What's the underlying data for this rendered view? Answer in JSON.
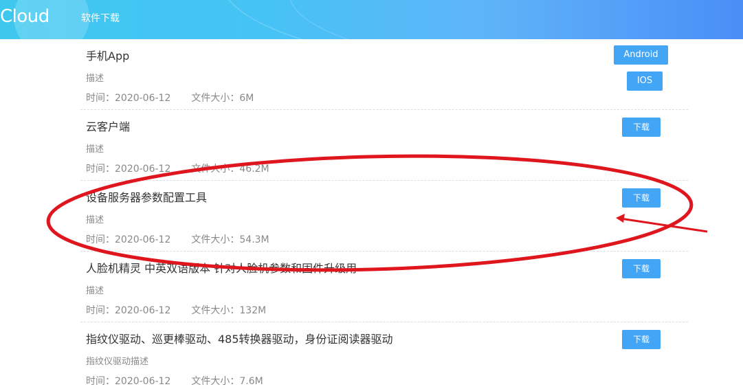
{
  "header": {
    "logo": "Cloud",
    "nav_item": "软件下载"
  },
  "items": [
    {
      "title": "手机App",
      "desc": "描述",
      "time": "时间：2020-06-12",
      "size": "文件大小：6M",
      "buttons": {
        "android": "Android",
        "ios": "IOS"
      }
    },
    {
      "title": "云客户端",
      "desc": "描述",
      "time": "时间：2020-06-12",
      "size": "文件大小：46.2M",
      "button": "下载"
    },
    {
      "title": "设备服务器参数配置工具",
      "desc": "描述",
      "time": "时间：2020-06-12",
      "size": "文件大小：54.3M",
      "button": "下载"
    },
    {
      "title": "人脸机精灵 中英双语版本 针对人脸机参数和固件升级用",
      "desc": "描述",
      "time": "时间：2020-06-12",
      "size": "文件大小：132M",
      "button": "下载"
    },
    {
      "title": "指纹仪驱动、巡更棒驱动、485转换器驱动，身份证阅读器驱动",
      "desc": "指纹仪驱动描述",
      "time": "时间：2020-06-12",
      "size": "文件大小：7.6M",
      "button": "下载"
    }
  ],
  "colors": {
    "button": "#42a5f5",
    "annotation": "#e0161e"
  }
}
